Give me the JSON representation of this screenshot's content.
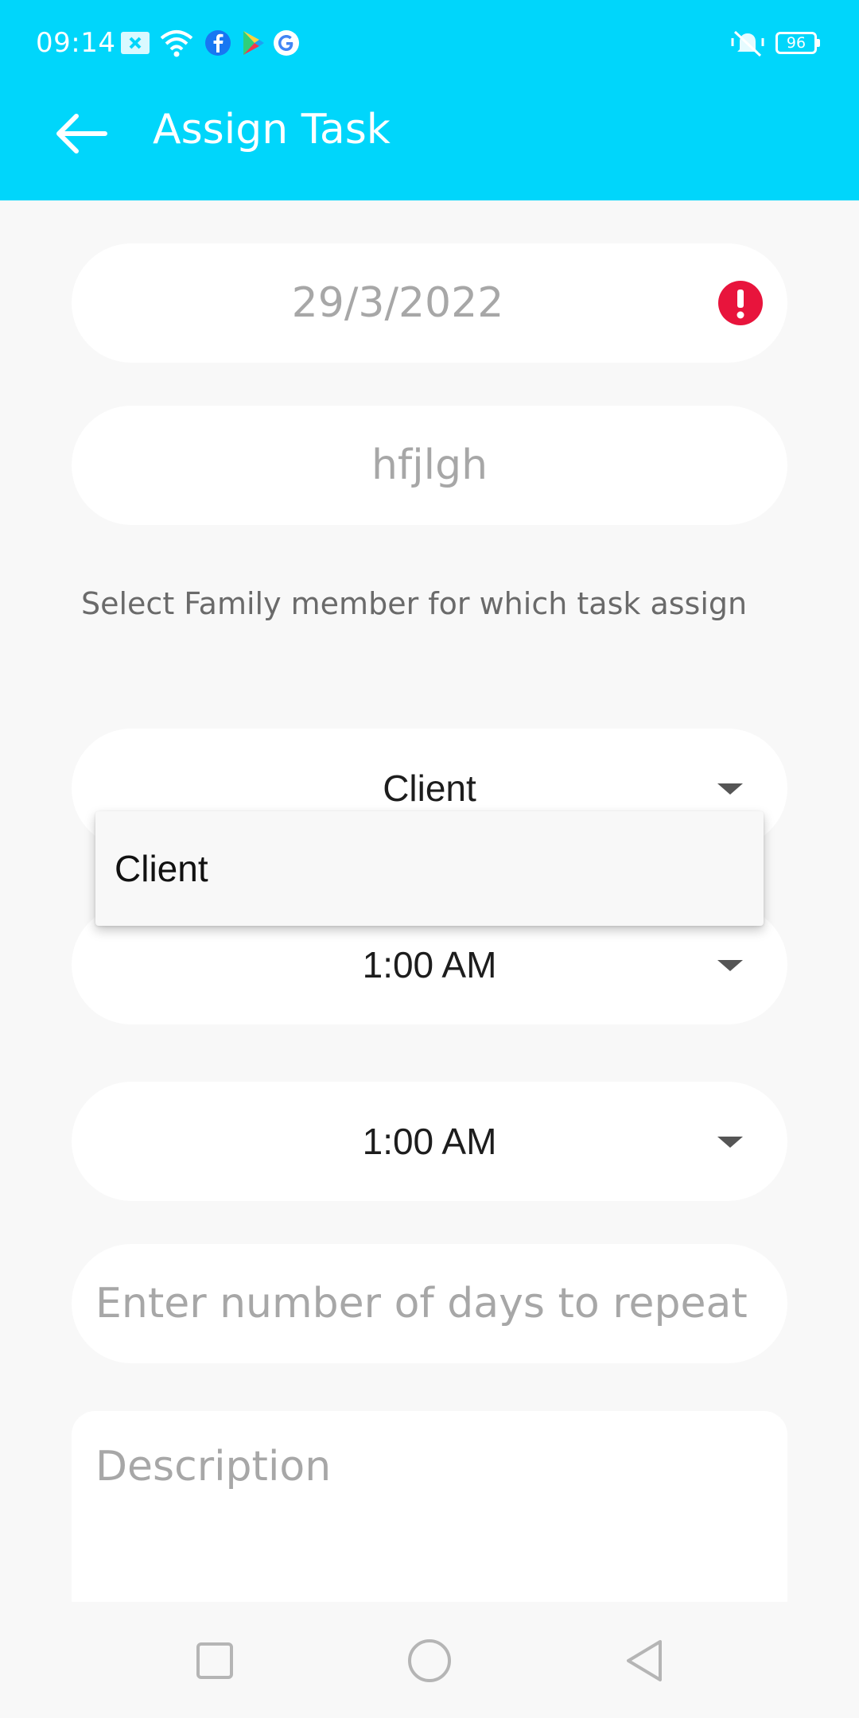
{
  "status_bar": {
    "time": "09:14",
    "battery": "96",
    "icons": [
      "image-notification-icon",
      "wifi-icon",
      "facebook-icon",
      "play-store-icon",
      "google-icon",
      "vibrate-icon",
      "battery-icon"
    ]
  },
  "header": {
    "title": "Assign Task",
    "back_icon": "arrow-left-icon",
    "background": "#00d6fb"
  },
  "form": {
    "date": "29/3/2022",
    "task_name": "hfjlgh",
    "member_prompt": "Select Family member for which task assign",
    "member_selected": "Client",
    "member_options": [
      "Client"
    ],
    "start_time": "1:00 AM",
    "end_time": "1:00 AM",
    "repeat_days_placeholder": "Enter number of days to repeat",
    "description_placeholder": "Description",
    "error_color": "#e8143c"
  },
  "nav": {
    "icons": [
      "recents-square-icon",
      "home-circle-icon",
      "back-triangle-icon"
    ]
  }
}
